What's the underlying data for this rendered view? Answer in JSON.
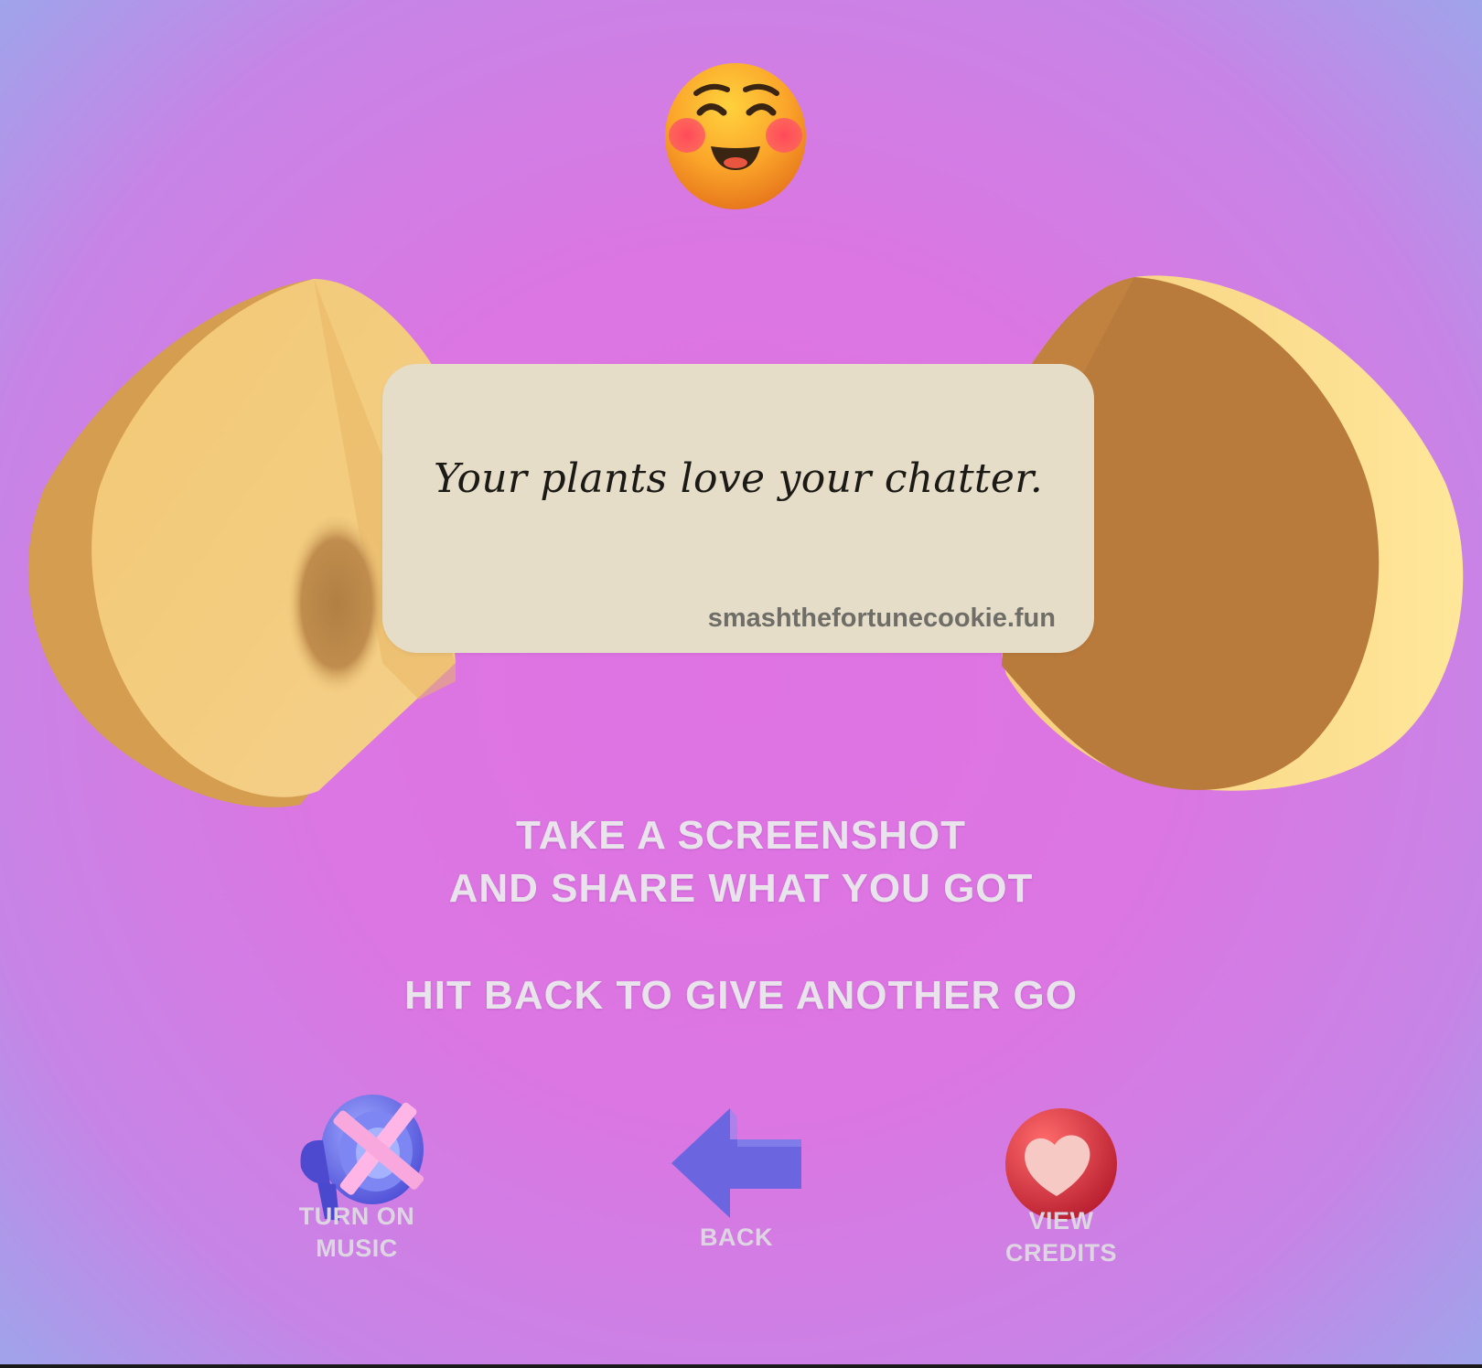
{
  "fortune": {
    "message": "Your plants love your chatter.",
    "site": "smashthefortunecookie.fun"
  },
  "instructions": {
    "line1": "TAKE A SCREENSHOT",
    "line2": "AND SHARE WHAT YOU GOT",
    "line3": "HIT BACK TO GIVE ANOTHER GO"
  },
  "controls": {
    "music_line1": "TURN ON",
    "music_line2": "MUSIC",
    "back": "BACK",
    "credits_line1": "VIEW",
    "credits_line2": "CREDITS"
  },
  "icons": {
    "emoji": "smiling-face-with-blush-icon",
    "music": "speaker-muted-icon",
    "back": "arrow-left-icon",
    "credits": "heart-icon"
  },
  "colors": {
    "background_center": "#df73e3",
    "background_edge": "#8fb1ec",
    "card": "#e5ddc7",
    "text": "#e9e4ec",
    "arrow": "#6b66e0",
    "heart_circle": "#d63c45"
  }
}
